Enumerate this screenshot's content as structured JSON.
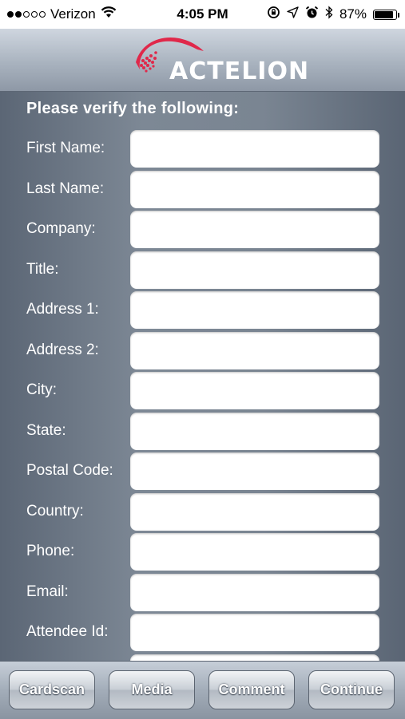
{
  "status_bar": {
    "carrier": "Verizon",
    "time": "4:05 PM",
    "battery_percent": "87%",
    "battery_level": 0.87,
    "signal_bars_filled": 2,
    "signal_bars_total": 5,
    "icons": [
      "wifi-icon",
      "rotation-lock-icon",
      "location-arrow-icon",
      "alarm-clock-icon",
      "bluetooth-icon",
      "battery-icon"
    ]
  },
  "header": {
    "logo_text": "ACTELION",
    "logo_color": "#e0284a"
  },
  "form": {
    "heading": "Please verify the following:",
    "fields": [
      {
        "label": "First Name:",
        "value": ""
      },
      {
        "label": "Last Name:",
        "value": ""
      },
      {
        "label": "Company:",
        "value": ""
      },
      {
        "label": "Title:",
        "value": ""
      },
      {
        "label": "Address 1:",
        "value": ""
      },
      {
        "label": "Address 2:",
        "value": ""
      },
      {
        "label": "City:",
        "value": ""
      },
      {
        "label": "State:",
        "value": ""
      },
      {
        "label": "Postal Code:",
        "value": ""
      },
      {
        "label": "Country:",
        "value": ""
      },
      {
        "label": "Phone:",
        "value": ""
      },
      {
        "label": "Email:",
        "value": ""
      },
      {
        "label": "Attendee Id:",
        "value": ""
      },
      {
        "label": "",
        "value": ""
      }
    ]
  },
  "toolbar": {
    "buttons": [
      {
        "label": "Cardscan"
      },
      {
        "label": "Media"
      },
      {
        "label": "Comment"
      },
      {
        "label": "Continue"
      }
    ]
  }
}
